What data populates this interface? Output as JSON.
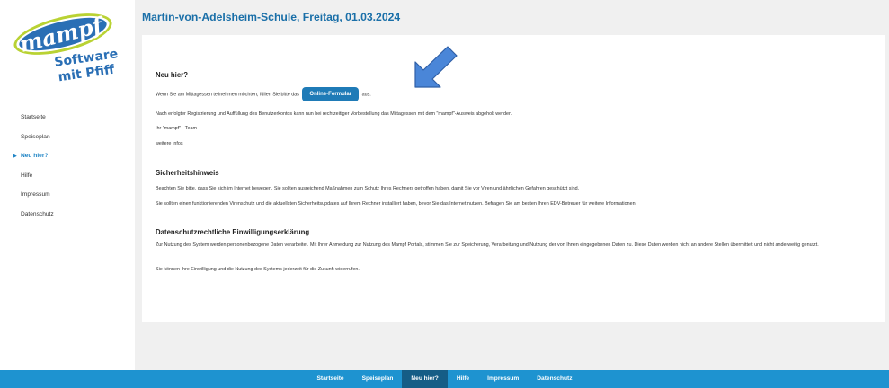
{
  "logo": {
    "brand": "mampf",
    "tagline_1": "Software",
    "tagline_2": "mit Pfiff"
  },
  "sidebar": {
    "items": [
      {
        "label": "Startseite"
      },
      {
        "label": "Speiseplan"
      },
      {
        "label": "Neu hier?"
      },
      {
        "label": "Hilfe"
      },
      {
        "label": "Impressum"
      },
      {
        "label": "Datenschutz"
      }
    ],
    "active_marker": "▶"
  },
  "header": {
    "title": "Martin-von-Adelsheim-Schule, Freitag, 01.03.2024"
  },
  "content": {
    "neu_hier": {
      "heading": "Neu hier?",
      "intro_before": "Wenn Sie am Mittagessen teilnehmen möchten, füllen Sie bitte das",
      "button_label": "Online-Formular",
      "intro_after": "aus.",
      "registration_text": "Nach erfolgter Registrierung und Auffüllung des Benutzerkontos kann nun bei rechtzeitiger Vorbestellung das Mittagessen mit dem \"mampf\"-Ausweis abgeholt werden.",
      "signature": "Ihr \"mampf\" - Team",
      "more_info": "weitere Infos"
    },
    "sicherheit": {
      "heading": "Sicherheitshinweis",
      "p1": "Beachten Sie bitte, dass Sie sich im Internet bewegen. Sie sollten ausreichend Maßnahmen zum Schutz Ihres Rechners getroffen haben, damit Sie vor Viren und ähnlichen Gefahren geschützt sind.",
      "p2": "Sie sollten einen funktionierenden Virenschutz und die aktuellsten Sicherheitsupdates auf Ihrem Rechner installiert haben, bevor Sie das Internet nutzen. Befragen Sie am besten Ihren EDV-Betreuer für weitere Informationen."
    },
    "datenschutz": {
      "heading": "Datenschutzrechtliche Einwilligungserklärung",
      "p1": "Zur Nutzung des System werden personenbezogene Daten verarbeitet. Mit Ihrer Anmeldung zur Nutzung des Mampf Portals, stimmen Sie zur Speicherung, Verarbeitung und Nutzung der von Ihnen eingegebenen Daten zu. Diese Daten werden nicht an andere Stellen übermittelt und nicht anderweitig genutzt.",
      "p2": "Sie können Ihre Einwilligung und die Nutzung des Systems jederzeit für die Zukunft widerrufen."
    }
  },
  "footer": {
    "items": [
      {
        "label": "Startseite"
      },
      {
        "label": "Speiseplan"
      },
      {
        "label": "Neu hier?"
      },
      {
        "label": "Hilfe"
      },
      {
        "label": "Impressum"
      },
      {
        "label": "Datenschutz"
      }
    ]
  },
  "colors": {
    "title_blue": "#1a6fa8",
    "button_blue": "#1f7bb7",
    "footer_blue": "#1e93d0",
    "footer_active": "#155d86",
    "arrow_blue": "#4a86d8",
    "logo_blue": "#2a6fb5",
    "logo_green": "#b9d233"
  }
}
